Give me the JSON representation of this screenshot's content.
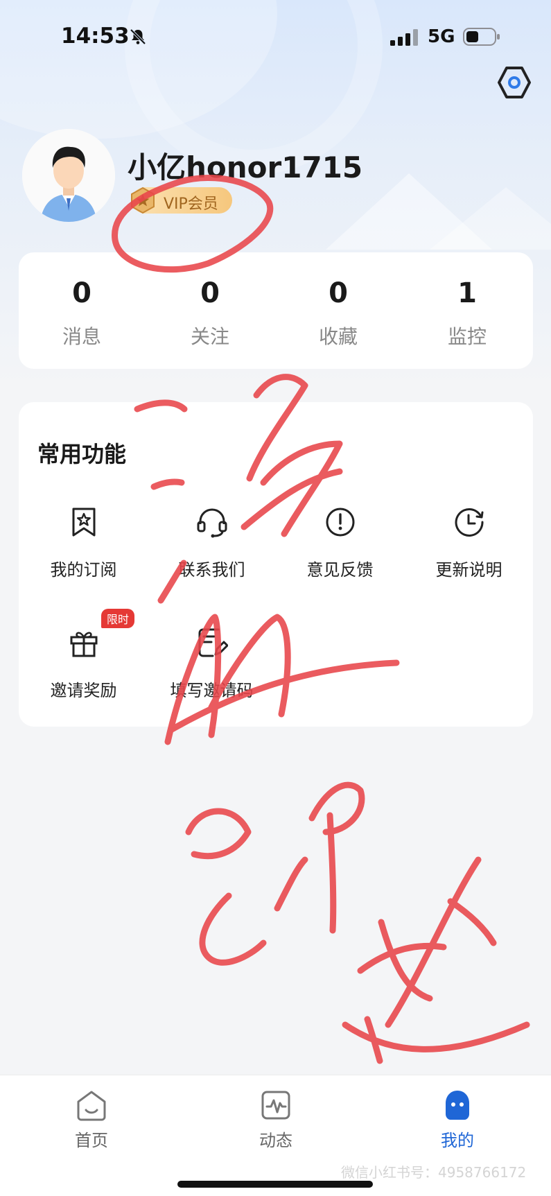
{
  "status_bar": {
    "time": "14:53",
    "network": "5G"
  },
  "profile": {
    "username": "小亿honor1715",
    "vip_label": "VIP会员"
  },
  "stats": [
    {
      "value": "0",
      "label": "消息"
    },
    {
      "value": "0",
      "label": "关注"
    },
    {
      "value": "0",
      "label": "收藏"
    },
    {
      "value": "1",
      "label": "监控"
    }
  ],
  "functions": {
    "title": "常用功能",
    "items": [
      {
        "label": "我的订阅",
        "icon": "subscription-icon"
      },
      {
        "label": "联系我们",
        "icon": "headset-icon"
      },
      {
        "label": "意见反馈",
        "icon": "feedback-icon"
      },
      {
        "label": "更新说明",
        "icon": "clock-icon"
      },
      {
        "label": "邀请奖励",
        "icon": "gift-icon",
        "badge": "限时"
      },
      {
        "label": "填写邀请码",
        "icon": "edit-document-icon"
      }
    ]
  },
  "tabbar": {
    "items": [
      {
        "label": "首页",
        "icon": "home-icon"
      },
      {
        "label": "动态",
        "icon": "activity-icon"
      },
      {
        "label": "我的",
        "icon": "profile-icon"
      }
    ],
    "active": "我的"
  },
  "watermark": "微信小红书号：4958766172",
  "annotation_text": "三毛钱开VIP即送",
  "colors": {
    "accent": "#1f66d6",
    "scribble": "#e8454a",
    "badge_red": "#e53935",
    "vip_gold": "#f6c77d"
  }
}
